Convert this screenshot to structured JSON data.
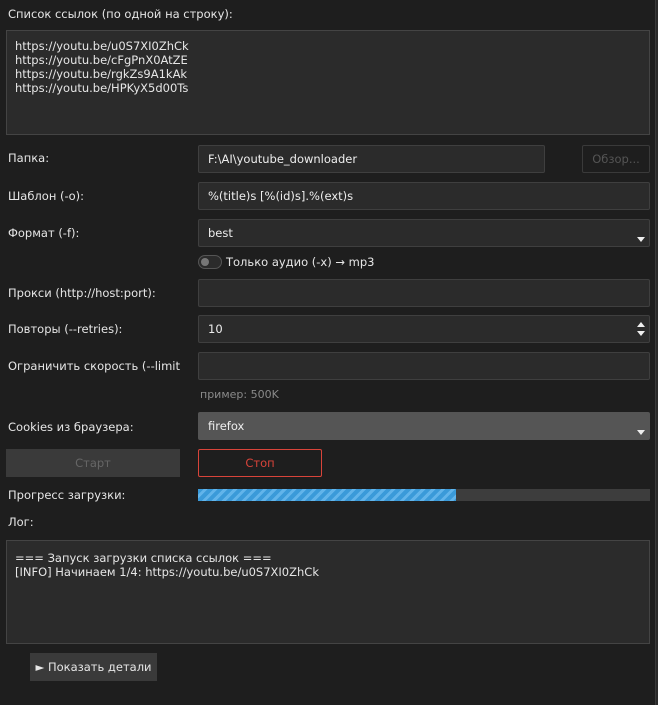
{
  "links": {
    "label": "Список ссылок (по одной на строку):",
    "value": "https://youtu.be/u0S7XI0ZhCk\nhttps://youtu.be/cFgPnX0AtZE\nhttps://youtu.be/rgkZs9A1kAk\nhttps://youtu.be/HPKyX5d00Ts"
  },
  "folder": {
    "label": "Папка:",
    "value": "F:\\AI\\youtube_downloader",
    "browse": "Обзор..."
  },
  "template": {
    "label": "Шаблон (-o):",
    "value": "%(title)s [%(id)s].%(ext)s"
  },
  "format": {
    "label": "Формат (-f):",
    "value": "best"
  },
  "audio_only": {
    "label": "Только аудио (-x) → mp3",
    "checked": false
  },
  "proxy": {
    "label": "Прокси (http://host:port):",
    "value": ""
  },
  "retries": {
    "label": "Повторы (--retries):",
    "value": "10"
  },
  "limit": {
    "label": "Ограничить скорость (--limit-rate):",
    "value": "",
    "hint": "пример: 500K"
  },
  "cookies": {
    "label": "Cookies из браузера:",
    "value": "firefox"
  },
  "buttons": {
    "start": "Старт",
    "stop": "Стоп",
    "details": "► Показать детали"
  },
  "progress": {
    "label": "Прогресс загрузки:",
    "percent": 57
  },
  "log": {
    "label": "Лог:",
    "value": "=== Запуск загрузки списка ссылок ===\n[INFO] Начинаем 1/4: https://youtu.be/u0S7XI0ZhCk"
  },
  "colors": {
    "accent": "#3a9ad9",
    "stop": "#d9443a"
  }
}
